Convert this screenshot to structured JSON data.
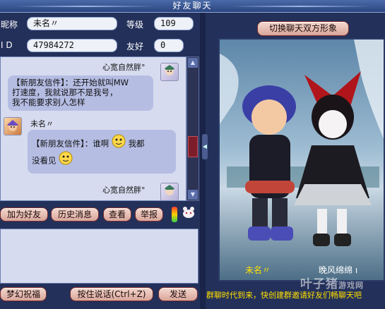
{
  "window": {
    "title": "好友聊天"
  },
  "info": {
    "nickname_label": "昵称",
    "nickname_value": "未名〃",
    "level_label": "等级",
    "level_value": "109",
    "id_label": "I D",
    "id_value": "47984272",
    "friendship_label": "友好",
    "friendship_value": "0"
  },
  "switch_button": "切换聊天双方形象",
  "chat": {
    "messages": [
      {
        "sender": "心宽自然胖°",
        "lines": [
          "【新朋友信件】：还开始就叫MW",
          "打速度，我就说那不是我号，",
          "我不能要求别人怎样"
        ]
      },
      {
        "sender": "未名〃",
        "lines": [
          "【新朋友信件】：谁啊",
          "我都",
          "没看见"
        ]
      },
      {
        "sender": "心宽自然胖°"
      }
    ]
  },
  "actions": {
    "add_friend": "加为好友",
    "history": "历史消息",
    "view": "查看",
    "report": "举报"
  },
  "bottom": {
    "wish": "梦幻祝福",
    "hold_to_talk": "按住说话(Ctrl+Z)",
    "send": "发送",
    "marquee": "群聊时代到来，快创建群邀请好友们畅聊天吧"
  },
  "scene": {
    "left_name": "未名〃",
    "right_name": "晚风绵绵 ı"
  },
  "watermark": {
    "line1": "叶子猪",
    "line2": "游戏网"
  },
  "colors": {
    "accent_yellow": "#ffe000",
    "button_border": "#7a2e2e",
    "panel_bg": "#d6dbef",
    "bubble_bg": "#b5bde3"
  }
}
